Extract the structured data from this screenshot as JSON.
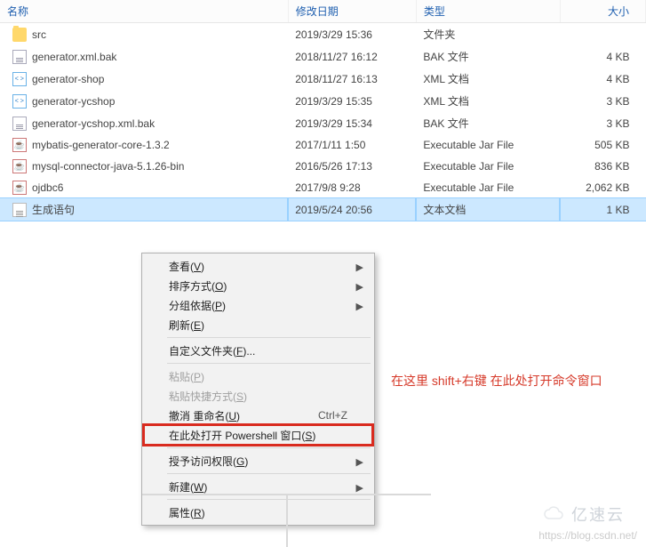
{
  "columns": {
    "name": "名称",
    "date": "修改日期",
    "type": "类型",
    "size": "大小"
  },
  "files": [
    {
      "icon": "folder",
      "name": "src",
      "date": "2019/3/29 15:36",
      "type": "文件夹",
      "size": ""
    },
    {
      "icon": "bak",
      "name": "generator.xml.bak",
      "date": "2018/11/27 16:12",
      "type": "BAK 文件",
      "size": "4 KB"
    },
    {
      "icon": "xml",
      "name": "generator-shop",
      "date": "2018/11/27 16:13",
      "type": "XML 文档",
      "size": "4 KB"
    },
    {
      "icon": "xml",
      "name": "generator-ycshop",
      "date": "2019/3/29 15:35",
      "type": "XML 文档",
      "size": "3 KB"
    },
    {
      "icon": "bak",
      "name": "generator-ycshop.xml.bak",
      "date": "2019/3/29 15:34",
      "type": "BAK 文件",
      "size": "3 KB"
    },
    {
      "icon": "jar",
      "name": "mybatis-generator-core-1.3.2",
      "date": "2017/1/11 1:50",
      "type": "Executable Jar File",
      "size": "505 KB"
    },
    {
      "icon": "jar",
      "name": "mysql-connector-java-5.1.26-bin",
      "date": "2016/5/26 17:13",
      "type": "Executable Jar File",
      "size": "836 KB"
    },
    {
      "icon": "jar",
      "name": "ojdbc6",
      "date": "2017/9/8 9:28",
      "type": "Executable Jar File",
      "size": "2,062 KB"
    },
    {
      "icon": "txt",
      "name": "生成语句",
      "date": "2019/5/24 20:56",
      "type": "文本文档",
      "size": "1 KB",
      "selected": true
    }
  ],
  "menu": {
    "view": {
      "label": "查看",
      "mn": "V",
      "arrow": true
    },
    "sort": {
      "label": "排序方式",
      "mn": "O",
      "arrow": true
    },
    "group": {
      "label": "分组依据",
      "mn": "P",
      "arrow": true
    },
    "refresh": {
      "label": "刷新",
      "mn": "E"
    },
    "customize": {
      "label": "自定义文件夹",
      "mn": "F",
      "tail": "..."
    },
    "paste": {
      "label": "粘贴",
      "mn": "P",
      "disabled": true
    },
    "pasteShort": {
      "label": "粘贴快捷方式",
      "mn": "S",
      "disabled": true
    },
    "undo": {
      "label": "撤消 重命名",
      "mn": "U",
      "shortcut": "Ctrl+Z"
    },
    "powershell": {
      "label": "在此处打开 Powershell 窗口",
      "mn": "S",
      "highlight": true
    },
    "access": {
      "label": "授予访问权限",
      "mn": "G",
      "arrow": true
    },
    "new": {
      "label": "新建",
      "mn": "W",
      "arrow": true
    },
    "props": {
      "label": "属性",
      "mn": "R"
    }
  },
  "annotation": "在这里 shift+右键 在此处打开命令窗口",
  "watermark": "https://blog.csdn.net/",
  "logo": "亿速云"
}
